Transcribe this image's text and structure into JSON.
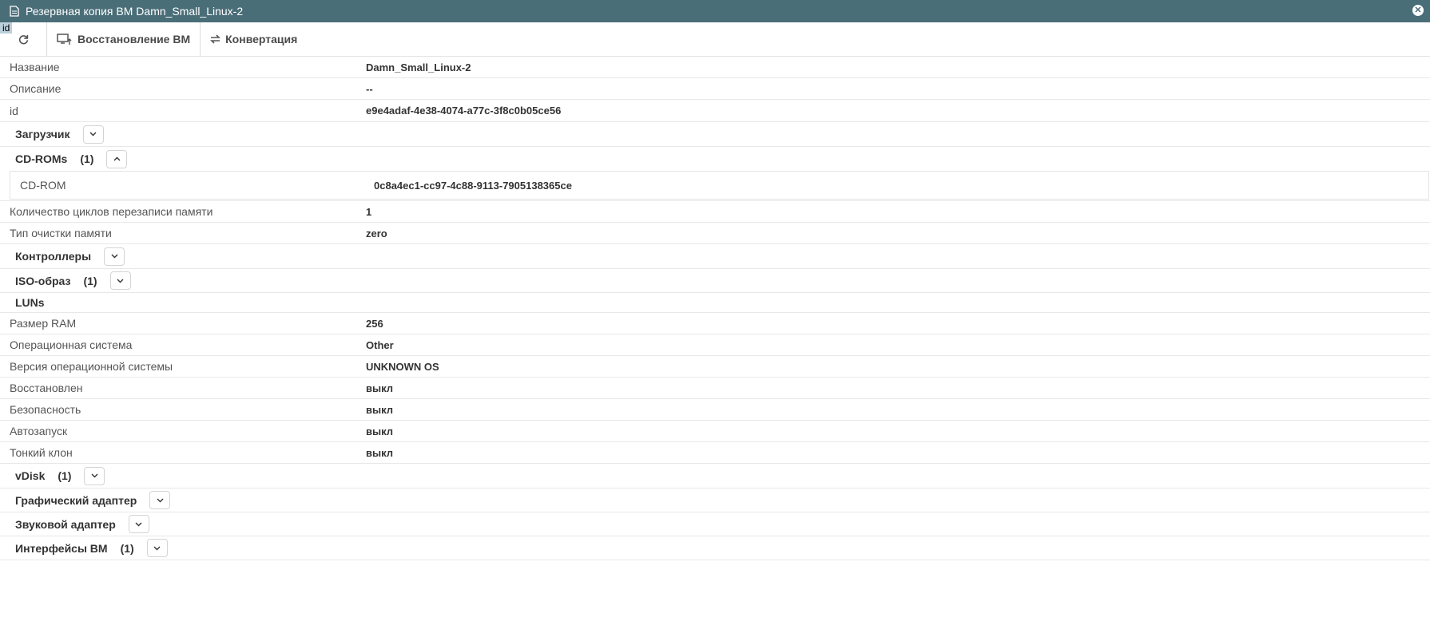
{
  "window": {
    "title": "Резервная копия ВМ Damn_Small_Linux-2",
    "close_icon": "close-icon",
    "id_badge": "id"
  },
  "toolbar": {
    "refresh_icon": "refresh-icon",
    "restore_label": "Восстановление ВМ",
    "convert_label": "Конвертация"
  },
  "props": {
    "name": {
      "label": "Название",
      "value": "Damn_Small_Linux-2"
    },
    "description": {
      "label": "Описание",
      "value": "--"
    },
    "id": {
      "label": "id",
      "value": "e9e4adaf-4e38-4074-a77c-3f8c0b05ce56"
    },
    "overwrite_cycles": {
      "label": "Количество циклов перезаписи памяти",
      "value": "1"
    },
    "wipe_type": {
      "label": "Тип очистки памяти",
      "value": "zero"
    },
    "ram": {
      "label": "Размер RAM",
      "value": "256"
    },
    "os": {
      "label": "Операционная система",
      "value": "Other"
    },
    "os_version": {
      "label": "Версия операционной системы",
      "value": "UNKNOWN OS"
    },
    "restored": {
      "label": "Восстановлен",
      "value": "выкл"
    },
    "security": {
      "label": "Безопасность",
      "value": "выкл"
    },
    "autostart": {
      "label": "Автозапуск",
      "value": "выкл"
    },
    "thin_clone": {
      "label": "Тонкий клон",
      "value": "выкл"
    }
  },
  "sections": {
    "loader": {
      "name": "Загрузчик"
    },
    "cdroms": {
      "name": "CD-ROMs",
      "count": "(1)",
      "item_label": "CD-ROM",
      "item_value": "0c8a4ec1-cc97-4c88-9113-7905138365ce"
    },
    "controllers": {
      "name": "Контроллеры"
    },
    "iso": {
      "name": "ISO-образ",
      "count": "(1)"
    },
    "luns": {
      "name": "LUNs"
    },
    "vdisk": {
      "name": "vDisk",
      "count": "(1)"
    },
    "gpu": {
      "name": "Графический адаптер"
    },
    "audio": {
      "name": "Звуковой адаптер"
    },
    "nics": {
      "name": "Интерфейсы ВМ",
      "count": "(1)"
    }
  }
}
